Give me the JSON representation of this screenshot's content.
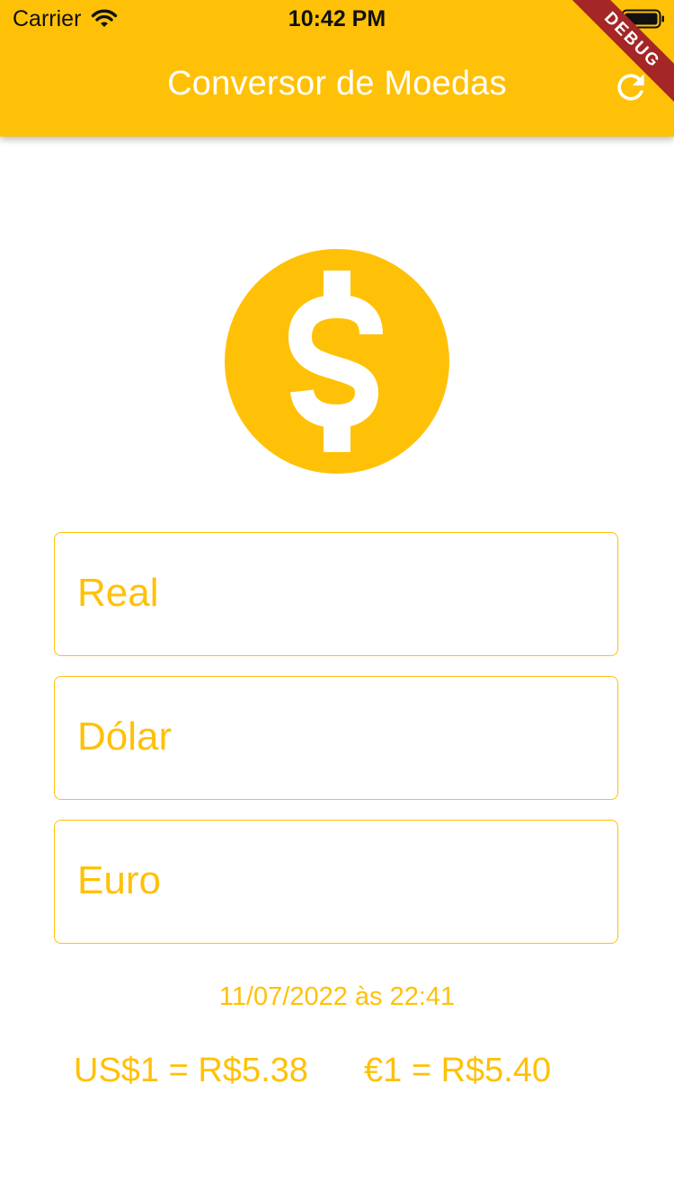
{
  "status_bar": {
    "carrier": "Carrier",
    "time": "10:42 PM"
  },
  "appbar": {
    "title": "Conversor de Moedas",
    "refresh_icon": "refresh-icon",
    "color": "#FFC107"
  },
  "debug_banner": {
    "label": "DEBUG",
    "color": "#A52626"
  },
  "hero": {
    "icon": "monetization-icon",
    "color": "#FFC107"
  },
  "fields": [
    {
      "label": "Real",
      "value": ""
    },
    {
      "label": "Dólar",
      "value": ""
    },
    {
      "label": "Euro",
      "value": ""
    }
  ],
  "updated_at": "11/07/2022 às 22:41",
  "rates": {
    "usd": "US$1 = R$5.38",
    "eur": "€1 = R$5.40"
  }
}
